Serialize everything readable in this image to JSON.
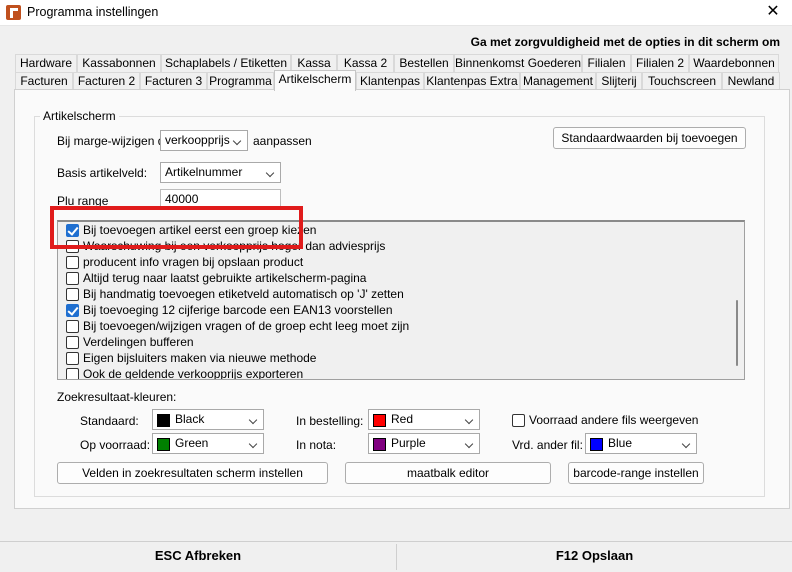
{
  "window": {
    "title": "Programma instellingen",
    "close_glyph": "✕"
  },
  "hint": "Ga met zorgvuldigheid met de opties in dit scherm om",
  "tabs_row1": [
    "Hardware",
    "Kassabonnen",
    "Schaplabels / Etiketten",
    "Kassa",
    "Kassa 2",
    "Bestellen",
    "Binnenkomst Goederen",
    "Filialen",
    "Filialen 2",
    "Waardebonnen"
  ],
  "tabs_row2": [
    "Facturen",
    "Facturen 2",
    "Facturen 3",
    "Programma",
    "Artikelscherm",
    "Klantenpas",
    "Klantenpas Extra",
    "Management",
    "Slijterij",
    "Touchscreen",
    "Newland"
  ],
  "active_tab": "Artikelscherm",
  "group": {
    "title": "Artikelscherm",
    "marge_label": "Bij marge-wijzigen de",
    "marge_value": "verkoopprijs",
    "marge_suffix": "aanpassen",
    "defaults_button": "Standaardwaarden bij toevoegen",
    "basis_label": "Basis artikelveld:",
    "basis_value": "Artikelnummer",
    "plu_label": "Plu range",
    "plu_value": "40000"
  },
  "options": [
    {
      "label": "Bij toevoegen artikel eerst een groep kiezen",
      "checked": true
    },
    {
      "label": "Waarschuwing bij een verkoopprijs hoger dan adviesprijs",
      "checked": false
    },
    {
      "label": "producent info vragen bij opslaan product",
      "checked": false
    },
    {
      "label": "Altijd terug naar laatst gebruikte artikelscherm-pagina",
      "checked": false
    },
    {
      "label": "Bij handmatig toevoegen etiketveld automatisch op 'J' zetten",
      "checked": false
    },
    {
      "label": "Bij toevoeging 12 cijferige barcode een EAN13 voorstellen",
      "checked": true
    },
    {
      "label": "Bij toevoegen/wijzigen vragen of de groep echt leeg moet zijn",
      "checked": false
    },
    {
      "label": "Verdelingen bufferen",
      "checked": false
    },
    {
      "label": "Eigen bijsluiters maken via nieuwe methode",
      "checked": false
    },
    {
      "label": "Ook de geldende verkoopprijs exporteren",
      "checked": false
    }
  ],
  "colors": {
    "title": "Zoekresultaat-kleuren:",
    "standaard": {
      "label": "Standaard:",
      "value": "Black",
      "hex": "#000000"
    },
    "bestelling": {
      "label": "In bestelling:",
      "value": "Red",
      "hex": "#ff0000"
    },
    "voorraad": {
      "label": "Op voorraad:",
      "value": "Green",
      "hex": "#008000"
    },
    "nota": {
      "label": "In nota:",
      "value": "Purple",
      "hex": "#800080"
    },
    "andere_fil_checkbox": "Voorraad andere fils weergeven",
    "vrd_label": "Vrd. ander fil:",
    "vrd": {
      "value": "Blue",
      "hex": "#0000ff"
    }
  },
  "buttons": {
    "velden": "Velden in zoekresultaten scherm instellen",
    "maatbalk": "maatbalk editor",
    "barcode": "barcode-range instellen"
  },
  "footer": {
    "esc": "ESC Afbreken",
    "save": "F12 Opslaan"
  }
}
